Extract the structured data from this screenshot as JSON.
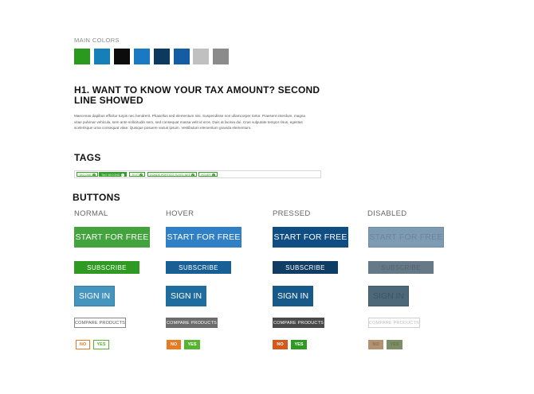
{
  "main_colors": {
    "label": "MAIN COLORS",
    "swatches": [
      "#2a9a1e",
      "#177fb8",
      "#0c0c0c",
      "#1b78c2",
      "#0b3a5e",
      "#125da4",
      "#c0c0c0",
      "#8b8b8b"
    ]
  },
  "typography": {
    "h1_line1": "H1. WANT TO KNOW YOUR TAX AMOUNT? SECOND",
    "h1_line2": "LINE SHOWED",
    "para_line1": "Maecenas dapibus efficitur turpis nec hendrerit. Phasellus sed elementum nisi. Suspendisse non ullamcorper tortor. Praesent interdum, magna",
    "para_line2": "vitae pulvinar vehicula, sem ante sollicitudin sem, sed consequat massa velit id eros. Duis at lacinia dui. Cras vulputate tempor risus, egestas",
    "para_line3": "scelerisque urna consequat vitae. Quisque posuere varius ipsum. Vestibulum elementum gravida elementum."
  },
  "tags": {
    "title": "TAGS",
    "items": [
      "TAG ONE",
      "TAG SECOND",
      "TEXT",
      "DONDE PORTICO TUYEL NEE",
      "HOVER"
    ]
  },
  "buttons": {
    "title": "BUTTONS",
    "columns": [
      "NORMAL",
      "HOVER",
      "PRESSED",
      "DISABLED"
    ],
    "start_label": "START FOR FREE",
    "subscribe_label": "SUBSCRIBE",
    "signin_label": "SIGN IN",
    "compare_label": "COMPARE PRODUCTS",
    "no_label": "NO",
    "yes_label": "YES"
  },
  "colors": {
    "green": "#43a33d",
    "green_dark": "#2f9a22",
    "blue": "#2f80c4",
    "teal": "#4595bf",
    "navy": "#0f4d82",
    "navy_dark": "#0f3d64",
    "disabled_blue": "#7e9bb4",
    "disabled_slate": "#677987",
    "orange": "#ea7a21",
    "lime": "#58b331"
  }
}
